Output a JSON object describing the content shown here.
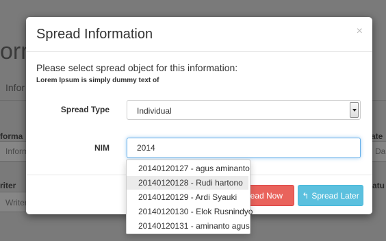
{
  "background": {
    "page_title_fragment": "orm",
    "section_fragment": "Infor",
    "col_left_header": "forma",
    "col_left_placeholder": "Inform",
    "col_right_header": "ate",
    "col_right_placeholder": "Da",
    "writer_header": "riter",
    "writer_placeholder": "Writer",
    "status_header": "tatu"
  },
  "modal": {
    "title": "Spread Information",
    "close_glyph": "×",
    "prompt": "Please select spread object for this information:",
    "subtext": "Lorem Ipsum is simply dummy text of",
    "spread_type_label": "Spread Type",
    "spread_type_value": "Individual",
    "nim_label": "NIM",
    "nim_value": "2014",
    "spread_now_label": "pread Now",
    "spread_later_icon": "↰",
    "spread_later_label": "Spread Later"
  },
  "autocomplete": {
    "items": [
      "20140120127 - agus aminanto",
      "20140120128 - Rudi hartono",
      "20140120129 - Ardi Syauki",
      "20140120130 - Elok Rusnindyo",
      "20140120131 - aminanto agus"
    ],
    "highlighted_index": 1
  },
  "colors": {
    "danger": "#e9635c",
    "info": "#5bc0de",
    "focus": "#66afe9"
  }
}
